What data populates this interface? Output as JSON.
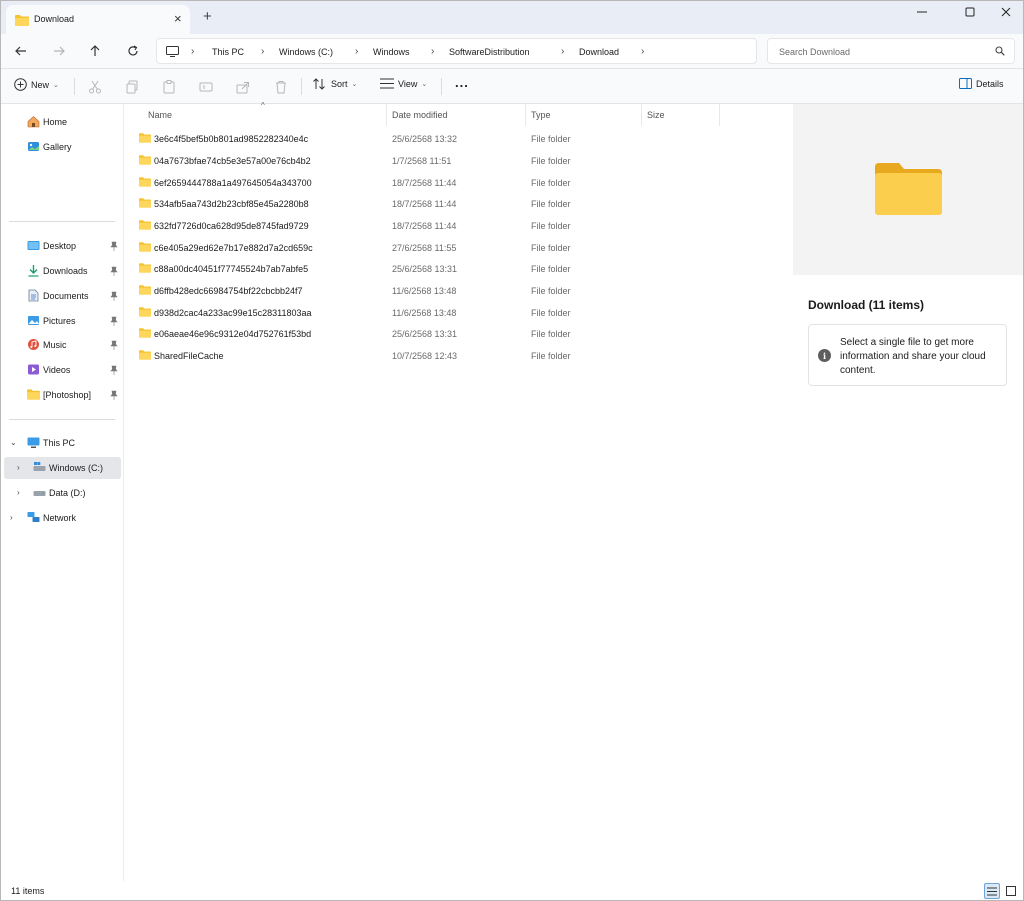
{
  "window": {
    "tab_title": "Download",
    "new_tab_symbol": "+",
    "close_tab_symbol": "×"
  },
  "breadcrumb": [
    "This PC",
    "Windows (C:)",
    "Windows",
    "SoftwareDistribution",
    "Download"
  ],
  "search": {
    "placeholder": "Search Download"
  },
  "toolbar": {
    "new_label": "New",
    "sort_label": "Sort",
    "view_label": "View",
    "more_label": "...",
    "details_label": "Details"
  },
  "sidebar": {
    "quick": [
      {
        "label": "Home",
        "icon": "home-icon"
      },
      {
        "label": "Gallery",
        "icon": "gallery-icon"
      }
    ],
    "pinned": [
      {
        "label": "Desktop",
        "icon": "desktop-icon"
      },
      {
        "label": "Downloads",
        "icon": "download-arrow-icon"
      },
      {
        "label": "Documents",
        "icon": "documents-icon"
      },
      {
        "label": "Pictures",
        "icon": "pictures-icon"
      },
      {
        "label": "Music",
        "icon": "music-icon"
      },
      {
        "label": "Videos",
        "icon": "videos-icon"
      },
      {
        "label": "[Photoshop]",
        "icon": "folder-icon"
      }
    ],
    "tree": [
      {
        "label": "This PC",
        "expanded": true
      },
      {
        "label": "Windows (C:)",
        "selected": true
      },
      {
        "label": "Data (D:)"
      },
      {
        "label": "Network"
      }
    ]
  },
  "columns": {
    "name": "Name",
    "date": "Date modified",
    "type": "Type",
    "size": "Size"
  },
  "files": [
    {
      "name": "3e6c4f5bef5b0b801ad9852282340e4c",
      "date": "25/6/2568 13:32",
      "type": "File folder"
    },
    {
      "name": "04a7673bfae74cb5e3e57a00e76cb4b2",
      "date": "1/7/2568 11:51",
      "type": "File folder"
    },
    {
      "name": "6ef2659444788a1a497645054a343700",
      "date": "18/7/2568 11:44",
      "type": "File folder"
    },
    {
      "name": "534afb5aa743d2b23cbf85e45a2280b8",
      "date": "18/7/2568 11:44",
      "type": "File folder"
    },
    {
      "name": "632fd7726d0ca628d95de8745fad9729",
      "date": "18/7/2568 11:44",
      "type": "File folder"
    },
    {
      "name": "c6e405a29ed62e7b17e882d7a2cd659c",
      "date": "27/6/2568 11:55",
      "type": "File folder"
    },
    {
      "name": "c88a00dc40451f77745524b7ab7abfe5",
      "date": "25/6/2568 13:31",
      "type": "File folder"
    },
    {
      "name": "d6ffb428edc66984754bf22cbcbb24f7",
      "date": "11/6/2568 13:48",
      "type": "File folder"
    },
    {
      "name": "d938d2cac4a233ac99e15c28311803aa",
      "date": "11/6/2568 13:48",
      "type": "File folder"
    },
    {
      "name": "e06aeae46e96c9312e04d752761f53bd",
      "date": "25/6/2568 13:31",
      "type": "File folder"
    },
    {
      "name": "SharedFileCache",
      "date": "10/7/2568 12:43",
      "type": "File folder"
    }
  ],
  "details_pane": {
    "title": "Download (11 items)",
    "info": "Select a single file to get more information and share your cloud content."
  },
  "status": {
    "item_count": "11 items"
  },
  "colors": {
    "folder_yellow": "#f4c430",
    "accent": "#0f6cbd",
    "titlebar_bg": "#e9eef6"
  }
}
